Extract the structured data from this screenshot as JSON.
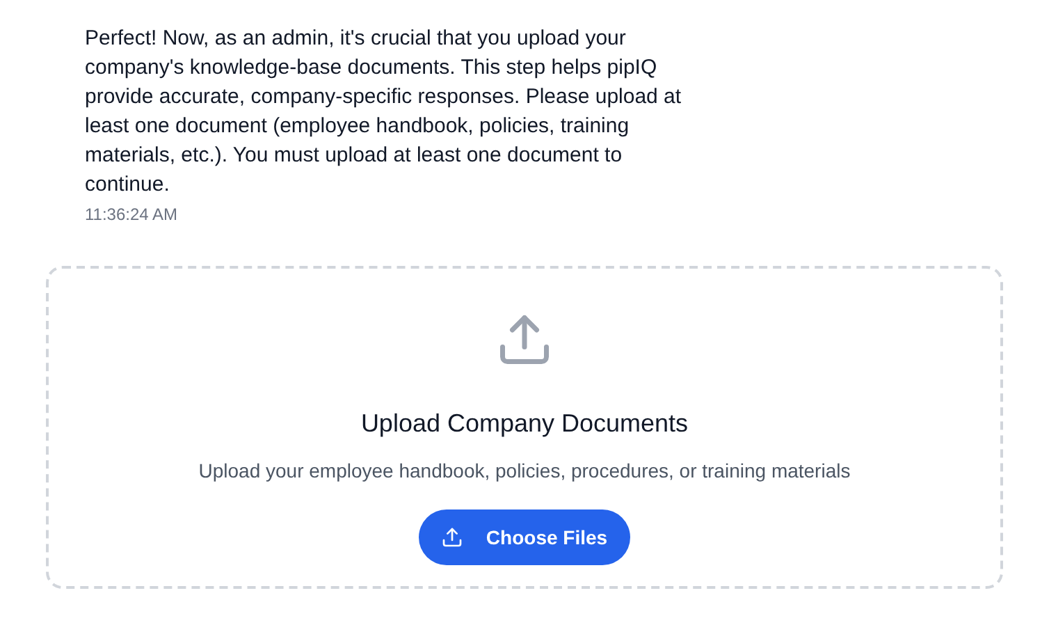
{
  "message": {
    "text": "Perfect! Now, as an admin, it's crucial that you upload your company's knowledge-base documents. This step helps pipIQ provide accurate, company-specific responses. Please upload at least one document (employee handbook, policies, training materials, etc.). You must upload at least one document to continue.",
    "time": "11:36:24 AM"
  },
  "upload": {
    "title": "Upload Company Documents",
    "subtitle": "Upload your employee handbook, policies, procedures, or training materials",
    "button": "Choose Files"
  }
}
